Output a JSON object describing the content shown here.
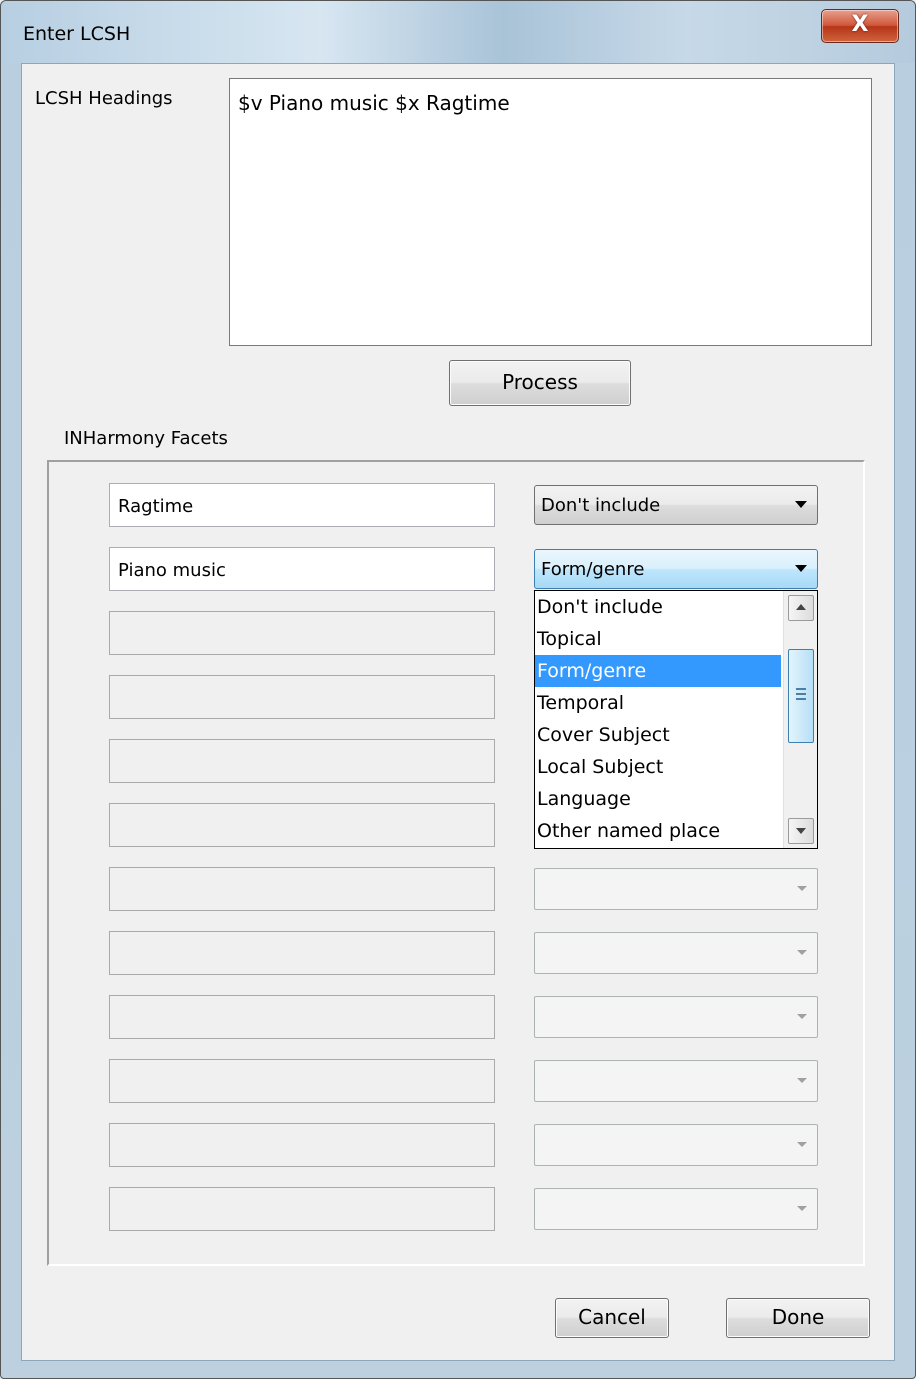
{
  "window": {
    "title": "Enter LCSH",
    "close_glyph": "X"
  },
  "lcsh": {
    "label": "LCSH Headings",
    "value": "$v Piano music $x Ragtime"
  },
  "process_label": "Process",
  "facets": {
    "label": "INHarmony Facets",
    "rows": [
      {
        "text": "Ragtime",
        "type": "Don't include"
      },
      {
        "text": "Piano music",
        "type": "Form/genre"
      }
    ],
    "dropdown_options": [
      "Don't include",
      "Topical",
      "Form/genre",
      "Temporal",
      "Cover Subject",
      "Local Subject",
      "Language",
      "Other named place"
    ],
    "selected_option": "Form/genre"
  },
  "buttons": {
    "cancel": "Cancel",
    "done": "Done"
  },
  "icons": {
    "close": "close-icon",
    "dropdown_arrow": "chevron-down-icon",
    "scroll_up": "scroll-up-icon",
    "scroll_down": "scroll-down-icon"
  }
}
